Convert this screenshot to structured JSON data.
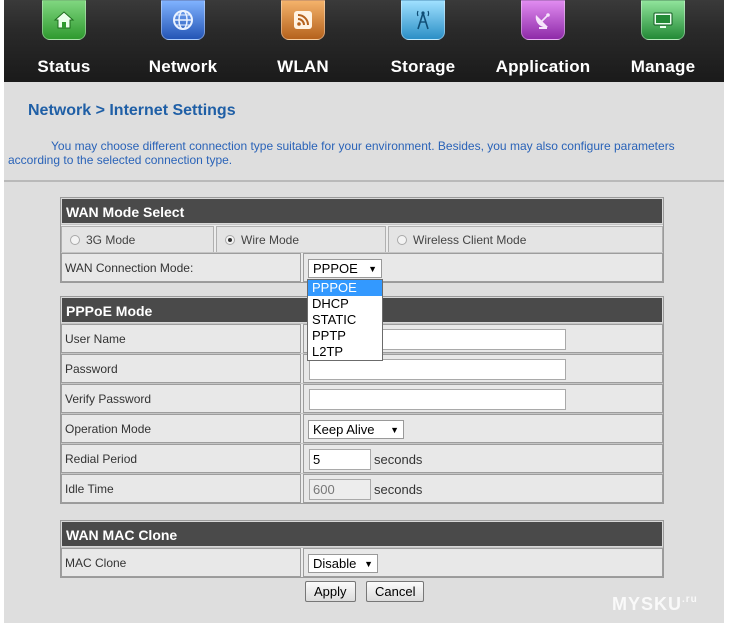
{
  "nav": {
    "items": [
      {
        "label": "Status",
        "icon": "house-icon",
        "color": "#3fae3f"
      },
      {
        "label": "Network",
        "icon": "globe-icon",
        "color": "#2f6fd0"
      },
      {
        "label": "WLAN",
        "icon": "rss-icon",
        "color": "#c9762a"
      },
      {
        "label": "Storage",
        "icon": "antenna-icon",
        "color": "#3ba3d8"
      },
      {
        "label": "Application",
        "icon": "satellite-dish-icon",
        "color": "#b24fc6"
      },
      {
        "label": "Manage",
        "icon": "monitor-icon",
        "color": "#38a84a"
      }
    ]
  },
  "page": {
    "title": "Network > Internet Settings",
    "description": "You may choose different connection type suitable for your environment. Besides, you may also configure parameters according to the selected connection type."
  },
  "wan_mode": {
    "header": "WAN Mode Select",
    "options": [
      {
        "label": "3G Mode",
        "checked": false
      },
      {
        "label": "Wire Mode",
        "checked": true
      },
      {
        "label": "Wireless Client Mode",
        "checked": false
      }
    ],
    "connection_label": "WAN Connection Mode:",
    "connection_value": "PPPOE",
    "connection_options": [
      "PPPOE",
      "DHCP",
      "STATIC",
      "PPTP",
      "L2TP"
    ]
  },
  "pppoe": {
    "header": "PPPoE Mode",
    "user_name_label": "User Name",
    "user_name_value": "",
    "password_label": "Password",
    "password_value": "",
    "verify_password_label": "Verify Password",
    "verify_password_value": "",
    "operation_mode_label": "Operation Mode",
    "operation_mode_value": "Keep Alive",
    "redial_period_label": "Redial Period",
    "redial_period_value": "5",
    "redial_unit": "seconds",
    "idle_time_label": "Idle Time",
    "idle_time_value": "600",
    "idle_unit": "seconds"
  },
  "mac_clone": {
    "header": "WAN MAC Clone",
    "label": "MAC Clone",
    "value": "Disable"
  },
  "buttons": {
    "apply": "Apply",
    "cancel": "Cancel"
  },
  "watermark": {
    "text": "MYSKU",
    "suffix": ".ru"
  }
}
